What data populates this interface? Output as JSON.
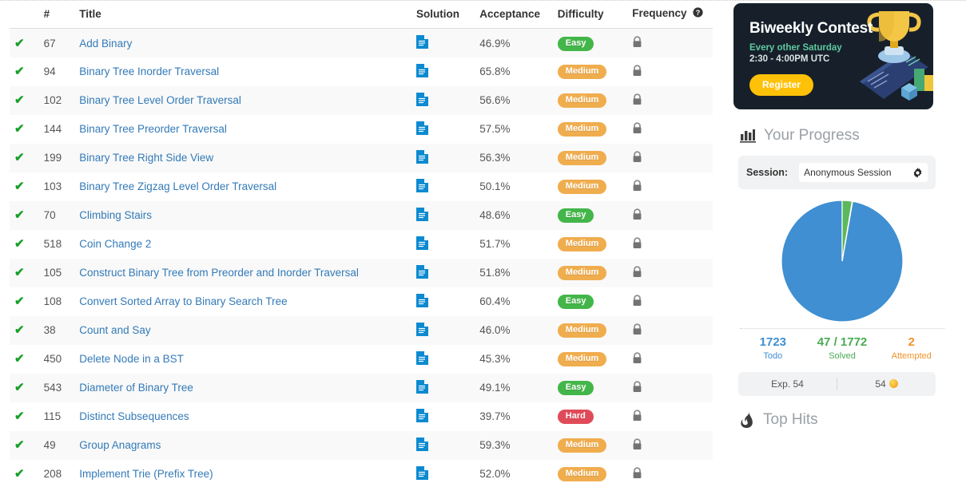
{
  "table": {
    "headers": {
      "status": "",
      "number": "#",
      "title": "Title",
      "solution": "Solution",
      "acceptance": "Acceptance",
      "difficulty": "Difficulty",
      "frequency": "Frequency",
      "frequency_help_icon": "help-circle-icon"
    },
    "rows": [
      {
        "status": "solved",
        "num": "67",
        "title": "Add Binary",
        "solution_icon": "document-icon",
        "acceptance": "46.9%",
        "difficulty": "Easy",
        "frequency_icon": "lock-icon"
      },
      {
        "status": "solved",
        "num": "94",
        "title": "Binary Tree Inorder Traversal",
        "solution_icon": "document-icon",
        "acceptance": "65.8%",
        "difficulty": "Medium",
        "frequency_icon": "lock-icon"
      },
      {
        "status": "solved",
        "num": "102",
        "title": "Binary Tree Level Order Traversal",
        "solution_icon": "document-icon",
        "acceptance": "56.6%",
        "difficulty": "Medium",
        "frequency_icon": "lock-icon"
      },
      {
        "status": "solved",
        "num": "144",
        "title": "Binary Tree Preorder Traversal",
        "solution_icon": "document-icon",
        "acceptance": "57.5%",
        "difficulty": "Medium",
        "frequency_icon": "lock-icon"
      },
      {
        "status": "solved",
        "num": "199",
        "title": "Binary Tree Right Side View",
        "solution_icon": "document-icon",
        "acceptance": "56.3%",
        "difficulty": "Medium",
        "frequency_icon": "lock-icon"
      },
      {
        "status": "solved",
        "num": "103",
        "title": "Binary Tree Zigzag Level Order Traversal",
        "solution_icon": "document-icon",
        "acceptance": "50.1%",
        "difficulty": "Medium",
        "frequency_icon": "lock-icon"
      },
      {
        "status": "solved",
        "num": "70",
        "title": "Climbing Stairs",
        "solution_icon": "document-icon",
        "acceptance": "48.6%",
        "difficulty": "Easy",
        "frequency_icon": "lock-icon"
      },
      {
        "status": "solved",
        "num": "518",
        "title": "Coin Change 2",
        "solution_icon": "document-icon",
        "acceptance": "51.7%",
        "difficulty": "Medium",
        "frequency_icon": "lock-icon"
      },
      {
        "status": "solved",
        "num": "105",
        "title": "Construct Binary Tree from Preorder and Inorder Traversal",
        "solution_icon": "document-icon",
        "acceptance": "51.8%",
        "difficulty": "Medium",
        "frequency_icon": "lock-icon"
      },
      {
        "status": "solved",
        "num": "108",
        "title": "Convert Sorted Array to Binary Search Tree",
        "solution_icon": "document-icon",
        "acceptance": "60.4%",
        "difficulty": "Easy",
        "frequency_icon": "lock-icon"
      },
      {
        "status": "solved",
        "num": "38",
        "title": "Count and Say",
        "solution_icon": "document-icon",
        "acceptance": "46.0%",
        "difficulty": "Medium",
        "frequency_icon": "lock-icon"
      },
      {
        "status": "solved",
        "num": "450",
        "title": "Delete Node in a BST",
        "solution_icon": "document-icon",
        "acceptance": "45.3%",
        "difficulty": "Medium",
        "frequency_icon": "lock-icon"
      },
      {
        "status": "solved",
        "num": "543",
        "title": "Diameter of Binary Tree",
        "solution_icon": "document-icon",
        "acceptance": "49.1%",
        "difficulty": "Easy",
        "frequency_icon": "lock-icon"
      },
      {
        "status": "solved",
        "num": "115",
        "title": "Distinct Subsequences",
        "solution_icon": "document-icon",
        "acceptance": "39.7%",
        "difficulty": "Hard",
        "frequency_icon": "lock-icon"
      },
      {
        "status": "solved",
        "num": "49",
        "title": "Group Anagrams",
        "solution_icon": "document-icon",
        "acceptance": "59.3%",
        "difficulty": "Medium",
        "frequency_icon": "lock-icon"
      },
      {
        "status": "solved",
        "num": "208",
        "title": "Implement Trie (Prefix Tree)",
        "solution_icon": "document-icon",
        "acceptance": "52.0%",
        "difficulty": "Medium",
        "frequency_icon": "lock-icon"
      }
    ]
  },
  "sidebar": {
    "contest": {
      "title": "Biweekly Contest",
      "schedule_day": "Every other Saturday",
      "schedule_time": "2:30 - 4:00PM UTC",
      "register_label": "Register",
      "art_icon": "trophy-phone-icon",
      "background_color": "#17202a",
      "accent_color": "#5ec9a0",
      "button_color": "#ffc107"
    },
    "progress": {
      "heading_icon": "bar-chart-icon",
      "heading": "Your Progress",
      "session_label": "Session:",
      "session_value": "Anonymous Session",
      "session_gear_icon": "gear-icon",
      "stats": [
        {
          "value": "1723",
          "label": "Todo",
          "color": "#3f8fd2",
          "key": "todo"
        },
        {
          "value": "47 / 1772",
          "label": "Solved",
          "color": "#4aab52",
          "key": "solved"
        },
        {
          "value": "2",
          "label": "Attempted",
          "color": "#f0932b",
          "key": "attempted"
        }
      ],
      "exp_label": "Exp. 54",
      "coin_value": "54",
      "coin_icon": "coin-icon"
    },
    "top_hits": {
      "heading_icon": "fire-icon",
      "heading": "Top Hits"
    }
  },
  "chart_data": {
    "type": "pie",
    "title": "Your Progress",
    "labels": [
      "Todo",
      "Solved",
      "Attempted"
    ],
    "values": [
      1723,
      47,
      2
    ],
    "colors": [
      "#3f8fd2",
      "#5cb85c",
      "#f0932b"
    ],
    "total": 1772,
    "legend": "below",
    "grid": false
  }
}
